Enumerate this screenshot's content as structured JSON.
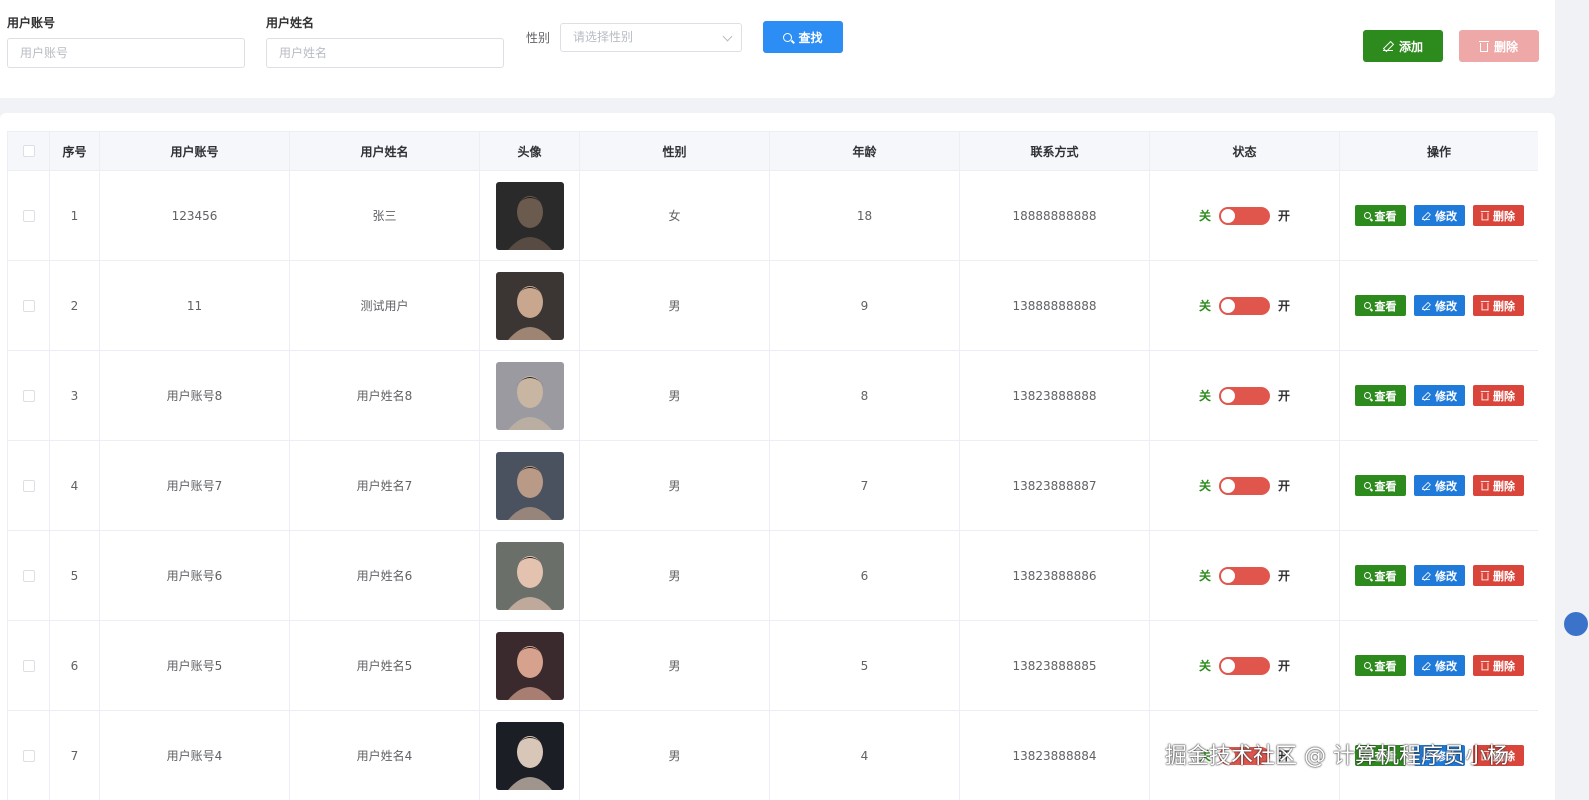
{
  "search": {
    "account_label": "用户账号",
    "account_placeholder": "用户账号",
    "name_label": "用户姓名",
    "name_placeholder": "用户姓名",
    "gender_label": "性别",
    "gender_placeholder": "请选择性别",
    "search_button": "查找",
    "add_button": "添加",
    "batch_delete_button": "删除"
  },
  "table": {
    "headers": {
      "index": "序号",
      "account": "用户账号",
      "name": "用户姓名",
      "avatar": "头像",
      "gender": "性别",
      "age": "年龄",
      "phone": "联系方式",
      "status": "状态",
      "actions": "操作"
    },
    "switch_off_label": "关",
    "switch_on_label": "开",
    "action_view": "查看",
    "action_edit": "修改",
    "action_delete": "删除",
    "rows": [
      {
        "index": "1",
        "account": "123456",
        "name": "张三",
        "gender": "女",
        "age": "18",
        "phone": "18888888888"
      },
      {
        "index": "2",
        "account": "11",
        "name": "测试用户",
        "gender": "男",
        "age": "9",
        "phone": "13888888888"
      },
      {
        "index": "3",
        "account": "用户账号8",
        "name": "用户姓名8",
        "gender": "男",
        "age": "8",
        "phone": "13823888888"
      },
      {
        "index": "4",
        "account": "用户账号7",
        "name": "用户姓名7",
        "gender": "男",
        "age": "7",
        "phone": "13823888887"
      },
      {
        "index": "5",
        "account": "用户账号6",
        "name": "用户姓名6",
        "gender": "男",
        "age": "6",
        "phone": "13823888886"
      },
      {
        "index": "6",
        "account": "用户账号5",
        "name": "用户姓名5",
        "gender": "男",
        "age": "5",
        "phone": "13823888885"
      },
      {
        "index": "7",
        "account": "用户账号4",
        "name": "用户姓名4",
        "gender": "男",
        "age": "4",
        "phone": "13823888884"
      }
    ]
  },
  "watermark": "掘金技术社区 @ 计算机程序员小杨",
  "colors": {
    "primary": "#2c8df4",
    "success": "#2d8a1d",
    "danger": "#d9453b",
    "danger_light": "#eea8a8"
  }
}
